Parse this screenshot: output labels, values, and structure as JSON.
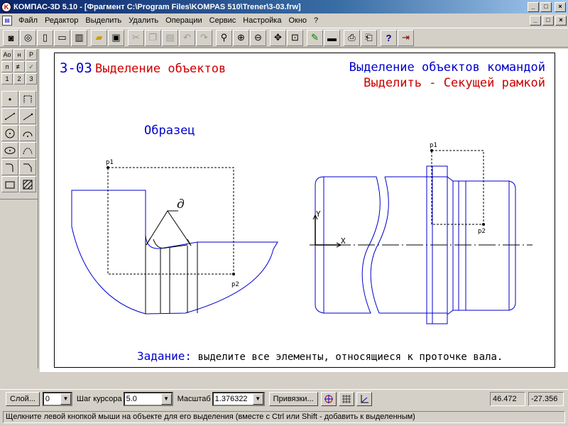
{
  "window": {
    "title": "КОМПАС-3D 5.10 - [Фрагмент C:\\Program Files\\KOMPAS 510\\Trener\\3-03.frw]",
    "minimize": "_",
    "maximize": "□",
    "close": "×"
  },
  "menu": [
    {
      "label": "Файл"
    },
    {
      "label": "Редактор"
    },
    {
      "label": "Выделить"
    },
    {
      "label": "Удалить"
    },
    {
      "label": "Операции"
    },
    {
      "label": "Сервис"
    },
    {
      "label": "Настройка"
    },
    {
      "label": "Окно"
    },
    {
      "label": "?"
    }
  ],
  "toolbar": {
    "icons": [
      "new-model-icon",
      "new-part-icon",
      "new-sheet-icon",
      "new-fragment-icon",
      "new-text-icon",
      "open-icon",
      "save-icon",
      "cut-icon",
      "copy-icon",
      "paste-icon",
      "undo-icon",
      "redo-icon",
      "zoom-icon",
      "zoom-in-icon",
      "zoom-out-icon",
      "pan-icon",
      "zoom-fit-icon",
      "edit-icon",
      "properties-icon",
      "print-preview-icon",
      "print-icon",
      "help-icon",
      "exit-icon"
    ]
  },
  "left_panel": {
    "top_buttons": [
      "Ао",
      "н",
      "Р",
      "п",
      "≢",
      "✓",
      "1",
      "2",
      "3"
    ]
  },
  "drawing": {
    "header_left_code": "3-03",
    "header_left_title": "Выделение объектов",
    "header_right_line1": "Выделение объектов командой",
    "header_right_line2": "Выделить - Секущей рамкой",
    "sample_label": "Образец",
    "symbol_d": "д",
    "p1_left": "p1",
    "p2_left": "p2",
    "p1_right": "p1",
    "p2_right": "p2",
    "axis_x": "X",
    "axis_y": "Y",
    "task_label": "Задание:",
    "task_text": " выделите все элементы, относящиеся к проточке вала.",
    "colors": {
      "blue": "#0000cc",
      "red": "#cc0000",
      "black": "#000000"
    }
  },
  "bottom_panel": {
    "layer_button": "Слой...",
    "layer_value": "0",
    "step_label": "Шаг курсора",
    "step_value": "5.0",
    "scale_label": "Масштаб",
    "scale_value": "1.376322",
    "snaps_button": "Привязки...",
    "coord_x": "46.472",
    "coord_y": "-27.356"
  },
  "status": {
    "text": "Щелкните левой кнопкой мыши на объекте для его выделения (вместе с Ctrl или Shift - добавить к выделенным)"
  }
}
